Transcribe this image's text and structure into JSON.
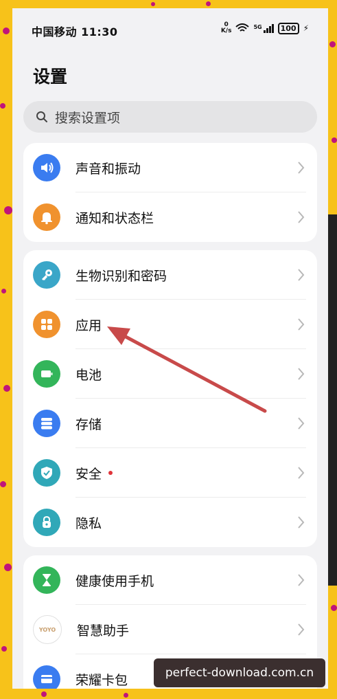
{
  "status_bar": {
    "carrier_time": "中国移动 11:30",
    "speed_value": "0",
    "speed_unit": "K/s",
    "network": "5G",
    "battery": "100"
  },
  "page": {
    "title": "设置"
  },
  "search": {
    "placeholder": "搜索设置项"
  },
  "groups": [
    {
      "items": [
        {
          "label": "声音和振动",
          "icon": "volume-icon",
          "color": "#3a7cf0"
        },
        {
          "label": "通知和状态栏",
          "icon": "bell-icon",
          "color": "#f0922e"
        }
      ]
    },
    {
      "items": [
        {
          "label": "生物识别和密码",
          "icon": "key-icon",
          "color": "#3aa6c8"
        },
        {
          "label": "应用",
          "icon": "apps-icon",
          "color": "#f0922e"
        },
        {
          "label": "电池",
          "icon": "battery-icon",
          "color": "#33b55a"
        },
        {
          "label": "存储",
          "icon": "storage-icon",
          "color": "#3a7cf0"
        },
        {
          "label": "安全",
          "icon": "shield-icon",
          "color": "#30a8b8",
          "badge": true
        },
        {
          "label": "隐私",
          "icon": "lock-icon",
          "color": "#30a8b8"
        }
      ]
    },
    {
      "items": [
        {
          "label": "健康使用手机",
          "icon": "hourglass-icon",
          "color": "#33b55a"
        },
        {
          "label": "智慧助手",
          "icon": "yoyo-icon",
          "color": "#ffffff",
          "icon_text": "YOYO"
        },
        {
          "label": "荣耀卡包",
          "icon": "wallet-icon",
          "color": "#3a7cf0"
        }
      ]
    }
  ],
  "annotation_arrow_color": "#c84a4a",
  "watermark": "perfect-download.com.cn"
}
